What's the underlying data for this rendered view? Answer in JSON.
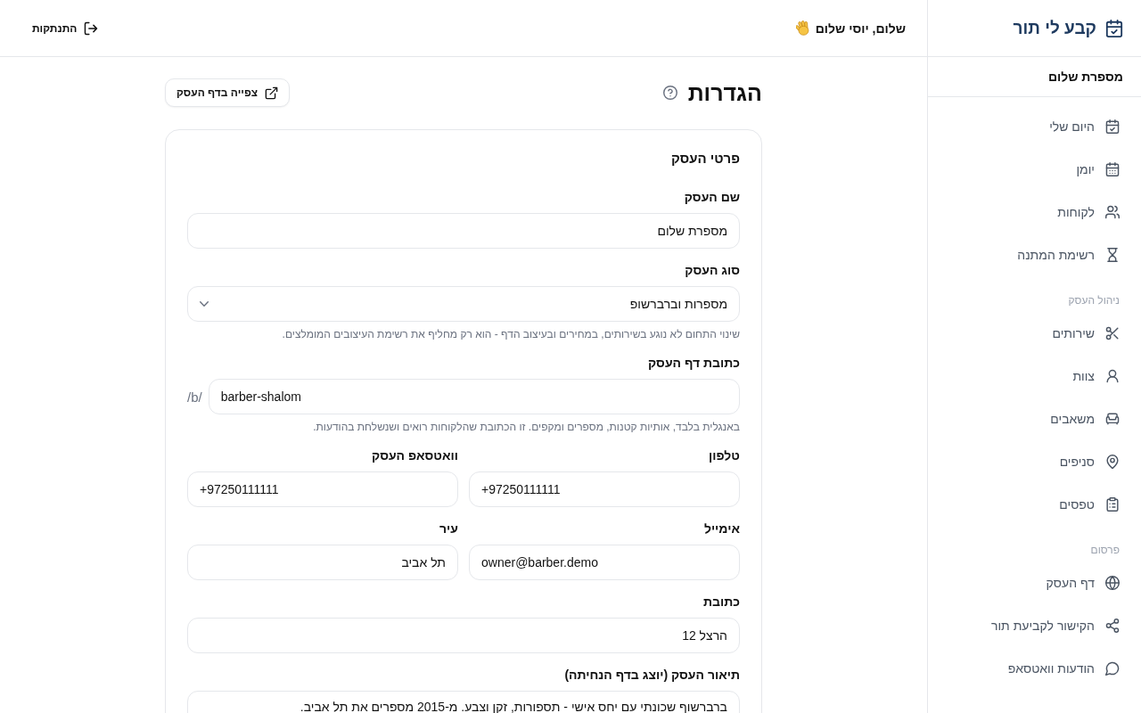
{
  "sidebar": {
    "logo": "קבע לי תור",
    "business_name": "מספרת שלום",
    "sections": [
      {
        "items": [
          {
            "label": "היום שלי",
            "selected": false
          },
          {
            "label": "יומן",
            "selected": false
          },
          {
            "label": "לקוחות",
            "selected": false
          },
          {
            "label": "רשימת המתנה",
            "selected": false
          }
        ]
      },
      {
        "heading": "ניהול העסק",
        "items": [
          {
            "label": "שירותים",
            "selected": false
          },
          {
            "label": "צוות",
            "selected": false
          },
          {
            "label": "משאבים",
            "selected": false
          },
          {
            "label": "סניפים",
            "selected": false
          },
          {
            "label": "טפסים",
            "selected": false
          }
        ]
      },
      {
        "heading": "פרסום",
        "items": [
          {
            "label": "דף העסק",
            "selected": false
          },
          {
            "label": "הקישור לקביעת תור",
            "selected": false
          },
          {
            "label": "הודעות וואטסאפ",
            "selected": false
          }
        ]
      }
    ]
  },
  "top_bar": {
    "greeting": "שלום, יוסי שלום",
    "logout": "התנתקות"
  },
  "page": {
    "title": "הגדרות",
    "view_button": "צפייה בדף העסק"
  },
  "card": {
    "title": "פרטי העסק",
    "rows": [
      {
        "fields": [
          {
            "kind": "text",
            "label": "שם העסק",
            "value": "מספרת שלום"
          }
        ]
      },
      {
        "fields": [
          {
            "kind": "select",
            "label": "סוג העסק",
            "value": "מספרות וברברשופ",
            "hint": "שינוי התחום לא נוגע בשירותים, במחירים ובעיצוב הדף - הוא רק מחליף את רשימת העיצובים המומלצים."
          }
        ]
      },
      {
        "fields": [
          {
            "kind": "prefixed",
            "label": "כתובת דף העסק",
            "prefix": "/b/",
            "value": "barber-shalom",
            "hint": "באנגלית בלבד, אותיות קטנות, מספרים ומקפים. זו הכתובת שהלקוחות רואים ושנשלחת בהודעות."
          }
        ]
      },
      {
        "fields": [
          {
            "kind": "text",
            "label": "טלפון",
            "value": "+97250111111"
          },
          {
            "kind": "text",
            "label": "וואטסאפ העסק",
            "value": "+97250111111"
          }
        ]
      },
      {
        "fields": [
          {
            "kind": "text",
            "label": "אימייל",
            "value": "owner@barber.demo"
          },
          {
            "kind": "text",
            "label": "עיר",
            "value": "תל אביב"
          }
        ]
      },
      {
        "fields": [
          {
            "kind": "text",
            "label": "כתובת",
            "value": "הרצל 12"
          }
        ]
      },
      {
        "fields": [
          {
            "kind": "textarea",
            "label": "תיאור העסק (יוצג בדף הנחיתה)",
            "value": "ברברשוף שכונתי עם יחס אישי - תספורות, זקן וצבע. מ-2015 מספרים את תל אביב."
          }
        ]
      }
    ]
  }
}
